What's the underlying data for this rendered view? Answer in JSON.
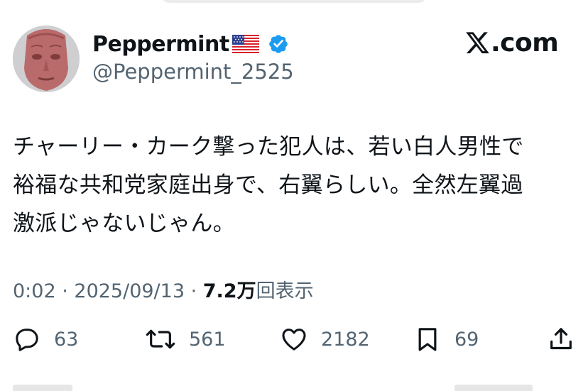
{
  "tweet": {
    "display_name": "Peppermint",
    "handle": "@Peppermint_2525",
    "site_label": ".com",
    "text_lines": [
      "チャーリー・カーク撃った犯人は、若い白人男性で",
      "裕福な共和党家庭出身で、右翼らしい。全然左翼過",
      "激派じゃないじゃん。"
    ],
    "time": "0:02",
    "separator": " · ",
    "date": "2025/09/13",
    "views_count": "7.2万",
    "views_label": "回表示"
  },
  "actions": {
    "replies": "63",
    "reposts": "561",
    "likes": "2182",
    "bookmarks": "69"
  },
  "icons": {
    "flag": "us-flag-icon",
    "verified": "verified-badge-icon",
    "reply": "reply-bubble-icon",
    "repost": "repost-icon",
    "like": "heart-icon",
    "bookmark": "bookmark-icon",
    "share": "share-icon"
  },
  "colors": {
    "text": "#0f1419",
    "secondary": "#536471",
    "verified_blue": "#1d9bf0",
    "avatar_face": "#b96a6a"
  }
}
